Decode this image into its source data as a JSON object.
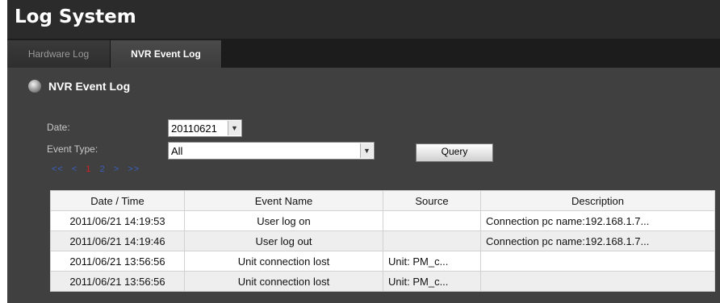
{
  "window": {
    "title": "Log System"
  },
  "tabs": [
    {
      "label": "Hardware Log"
    },
    {
      "label": "NVR Event Log",
      "active": true
    }
  ],
  "section": {
    "title": "NVR Event Log",
    "icon": "circle-bullet-icon"
  },
  "form": {
    "date_label": "Date:",
    "date_value": "20110621",
    "event_type_label": "Event Type:",
    "event_type_value": "All",
    "query_label": "Query"
  },
  "pager": {
    "first": "<<",
    "prev": "<",
    "page1": "1",
    "page2": "2",
    "next": ">",
    "last": ">>"
  },
  "table": {
    "headers": [
      "Date / Time",
      "Event Name",
      "Source",
      "Description"
    ],
    "rows": [
      [
        "2011/06/21 14:19:53",
        "User log on",
        "",
        "Connection pc name:192.168.1.7..."
      ],
      [
        "2011/06/21 14:19:46",
        "User log out",
        "",
        "Connection pc name:192.168.1.7..."
      ],
      [
        "2011/06/21 13:56:56",
        "Unit connection lost",
        "Unit: PM_c...",
        ""
      ],
      [
        "2011/06/21 13:56:56",
        "Unit connection lost",
        "Unit: PM_c...",
        ""
      ]
    ]
  },
  "colors": {
    "background": "#2b2b2b",
    "panel": "#404040",
    "pager_link": "#3b5fc0",
    "pager_current": "#d82020"
  }
}
